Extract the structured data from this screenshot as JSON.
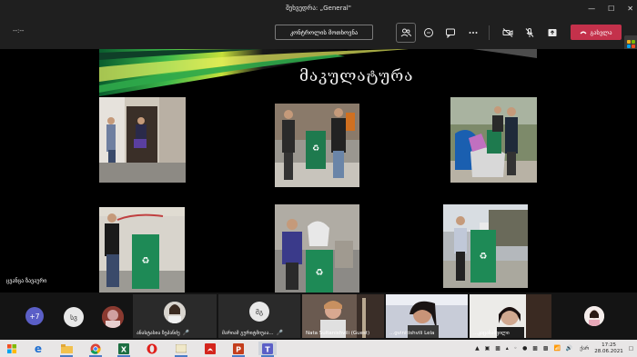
{
  "window": {
    "title": "შეხვედრა: „General\"",
    "min_icon": "minimize-icon",
    "max_icon": "maximize-icon",
    "close_icon": "close-icon"
  },
  "toolbar": {
    "timer": "--:--",
    "control_request_label": "კონტროლის მოთხოვნა",
    "icons": [
      "participants-icon",
      "chat-icon",
      "reactions-icon",
      "more-icon",
      "camera-off-icon",
      "mic-off-icon",
      "share-icon"
    ],
    "leave_label": "გასვლა",
    "leave_color": "#c4314b"
  },
  "slide": {
    "title": "მაკულატურა",
    "presenter_name": "ცვანცა ზავაური"
  },
  "participants": {
    "overflow_count": "+7",
    "initials_tile": "სვ",
    "tiles": [
      {
        "name": "ანასტასია ზეპანძე"
      },
      {
        "initials": "მგ",
        "name": "მარიამ გურიტმიუაა..."
      },
      {
        "name": "Nata Sultanishvili (Guest)"
      },
      {
        "name": "...gvinitishvili Lela"
      },
      {
        "name": "...კაცანაშვილი"
      }
    ]
  },
  "taskbar": {
    "apps": [
      "windows-start-icon",
      "edge-icon",
      "file-explorer-icon",
      "chrome-icon",
      "excel-icon",
      "opera-icon",
      "snipping-icon",
      "acrobat-icon",
      "powerpoint-icon",
      "teams-icon"
    ],
    "language": "ქარ",
    "time": "17:25",
    "date": "28.06.2021"
  }
}
